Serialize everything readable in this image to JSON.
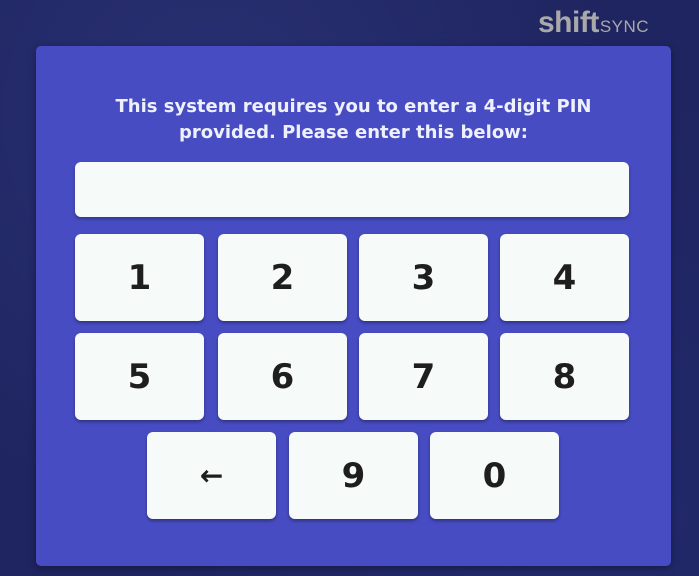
{
  "logo": {
    "main": "shift",
    "sub": "SYNC"
  },
  "prompt": {
    "text": "This system requires you to enter a 4-digit PIN provided. Please enter this below:"
  },
  "pin_input": {
    "value": "",
    "placeholder": ""
  },
  "keypad": {
    "keys": [
      {
        "label": "1"
      },
      {
        "label": "2"
      },
      {
        "label": "3"
      },
      {
        "label": "4"
      },
      {
        "label": "5"
      },
      {
        "label": "6"
      },
      {
        "label": "7"
      },
      {
        "label": "8"
      },
      {
        "label": "←",
        "icon": "arrow-left-icon"
      },
      {
        "label": "9"
      },
      {
        "label": "0"
      }
    ]
  },
  "colors": {
    "background": "#1f2560",
    "panel": "#474cc3",
    "key": "#f6faf9",
    "text_light": "#eef0fb",
    "logo": "#a9a9a9"
  }
}
